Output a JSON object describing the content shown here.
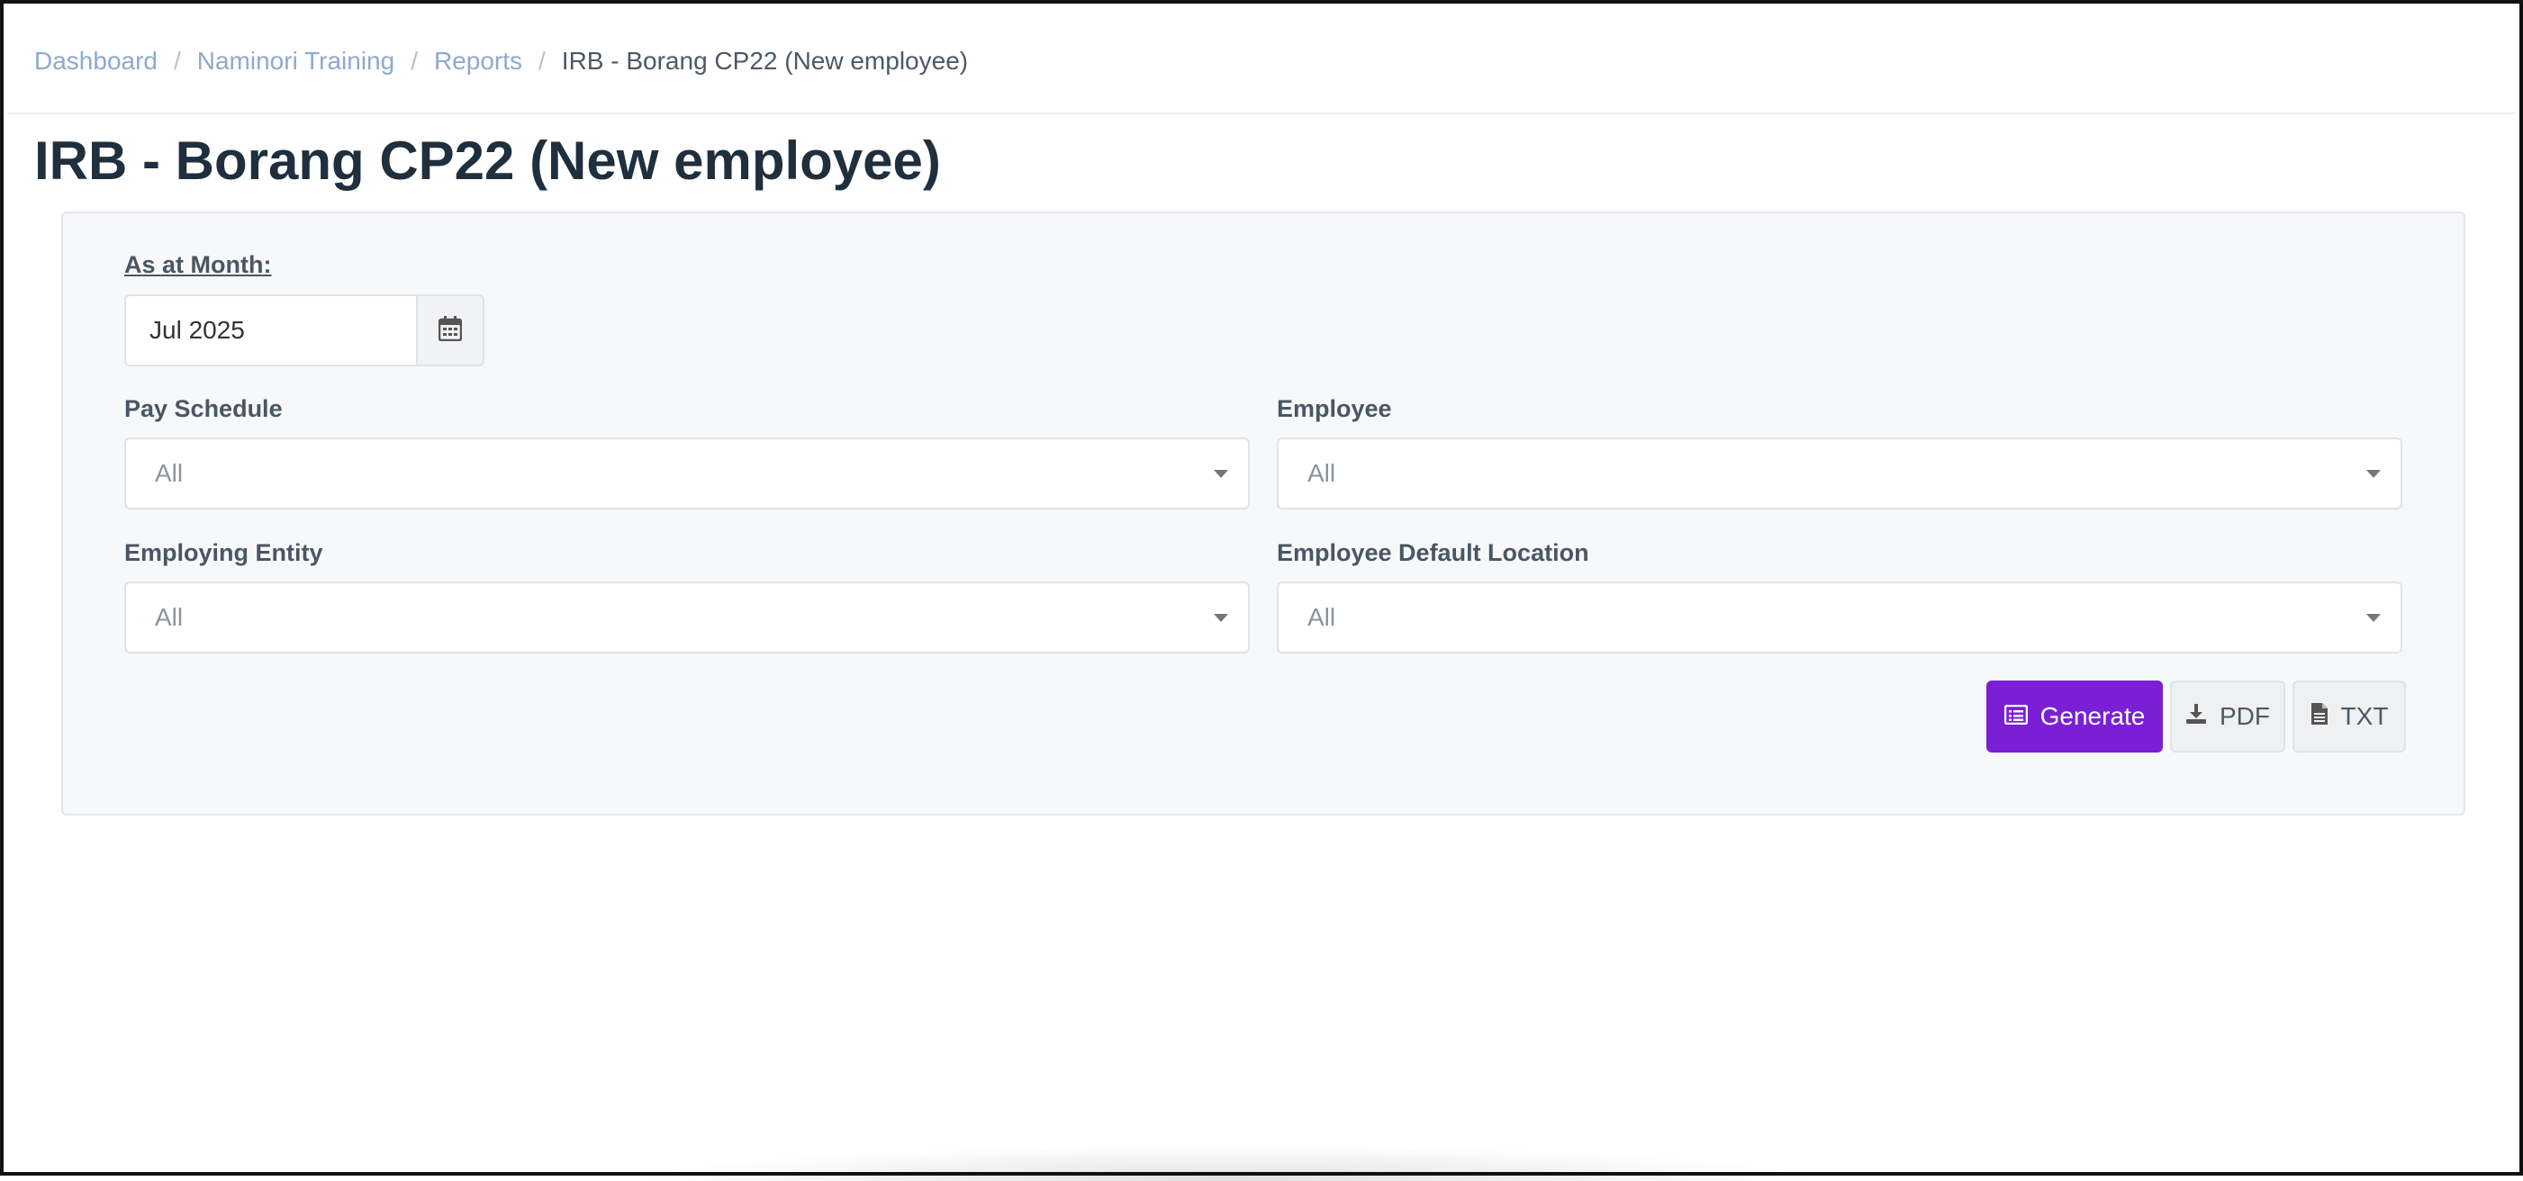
{
  "breadcrumb": {
    "items": [
      "Dashboard",
      "Naminori Training",
      "Reports"
    ],
    "separator": "/",
    "current": "IRB - Borang CP22 (New employee)"
  },
  "page": {
    "title": "IRB - Borang CP22 (New employee)"
  },
  "form": {
    "month_label": "As at Month:",
    "month_value": "Jul 2025",
    "pay_schedule_label": "Pay Schedule",
    "pay_schedule_value": "All",
    "employee_label": "Employee",
    "employee_value": "All",
    "employing_entity_label": "Employing Entity",
    "employing_entity_value": "All",
    "default_location_label": "Employee Default Location",
    "default_location_value": "All"
  },
  "actions": {
    "generate_label": "Generate",
    "pdf_label": "PDF",
    "txt_label": "TXT"
  },
  "colors": {
    "accent": "#7b1fd6",
    "link": "#8ea9cf",
    "title": "#1f2f3d"
  },
  "icons": {
    "calendar": "calendar-icon",
    "generate": "list-icon",
    "pdf": "download-icon",
    "txt": "file-text-icon"
  }
}
